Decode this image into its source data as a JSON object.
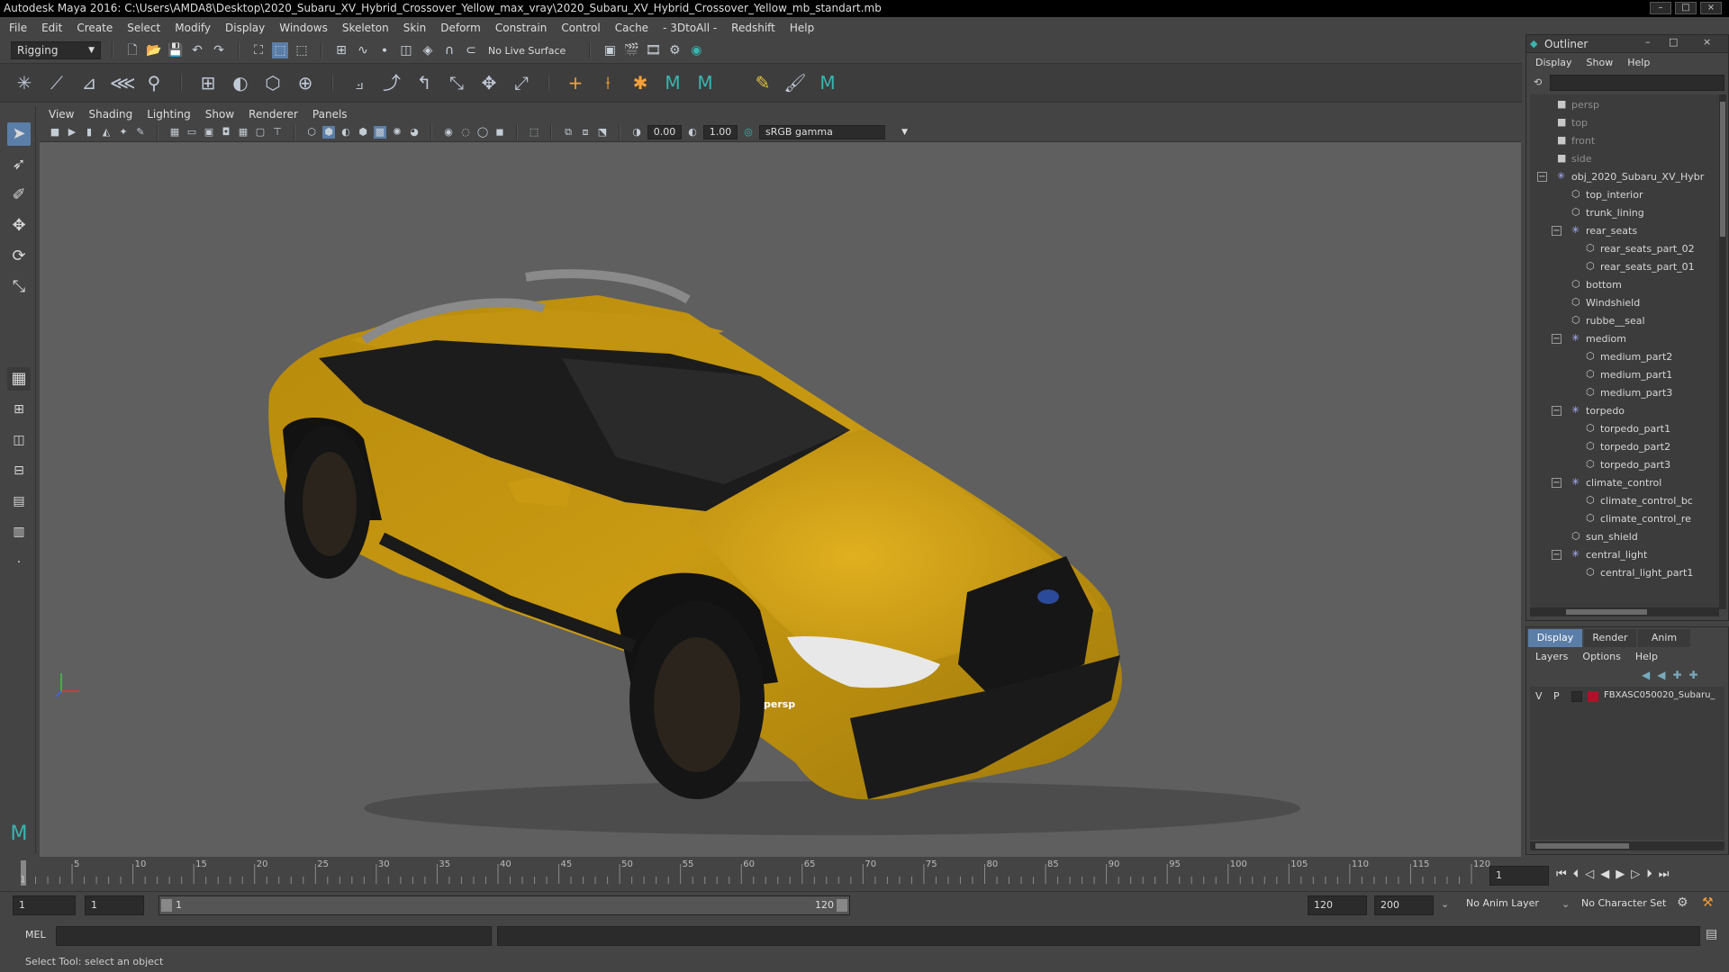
{
  "window": {
    "title": "Autodesk Maya 2016: C:\\Users\\AMDA8\\Desktop\\2020_Subaru_XV_Hybrid_Crossover_Yellow_max_vray\\2020_Subaru_XV_Hybrid_Crossover_Yellow_mb_standart.mb",
    "minimize": "–",
    "maximize": "□",
    "close": "×"
  },
  "menubar": [
    "File",
    "Edit",
    "Create",
    "Select",
    "Modify",
    "Display",
    "Windows",
    "Skeleton",
    "Skin",
    "Deform",
    "Constrain",
    "Control",
    "Cache",
    "- 3DtoAll -",
    "Redshift",
    "Help"
  ],
  "statusline": {
    "mode": "Rigging",
    "live_surface": "No Live Surface"
  },
  "viewport": {
    "menu": [
      "View",
      "Shading",
      "Lighting",
      "Show",
      "Renderer",
      "Panels"
    ],
    "exposure": "0.00",
    "gamma": "1.00",
    "colorspace": "sRGB gamma",
    "camera_label": "persp"
  },
  "timeline": {
    "ticks": [
      "1",
      "5",
      "10",
      "15",
      "20",
      "25",
      "30",
      "35",
      "40",
      "45",
      "50",
      "55",
      "60",
      "65",
      "70",
      "75",
      "80",
      "85",
      "90",
      "95",
      "100",
      "105",
      "110",
      "115",
      "120"
    ],
    "current_frame": "1"
  },
  "range": {
    "start": "1",
    "start_inner": "1",
    "slider_start": "1",
    "slider_end": "120",
    "end_inner": "120",
    "end": "200",
    "anim_layer": "No Anim Layer",
    "char_set": "No Character Set"
  },
  "mel": {
    "label": "MEL"
  },
  "help_line": "Select Tool: select an object",
  "outliner": {
    "title": "Outliner",
    "menu": [
      "Display",
      "Show",
      "Help"
    ],
    "items": [
      {
        "label": "persp",
        "indent": 0,
        "kind": "camera",
        "dim": true
      },
      {
        "label": "top",
        "indent": 0,
        "kind": "camera",
        "dim": true
      },
      {
        "label": "front",
        "indent": 0,
        "kind": "camera",
        "dim": true
      },
      {
        "label": "side",
        "indent": 0,
        "kind": "camera",
        "dim": true
      },
      {
        "label": "obj_2020_Subaru_XV_Hybr",
        "indent": 0,
        "kind": "group",
        "expanded": true
      },
      {
        "label": "top_interior",
        "indent": 1,
        "kind": "mesh"
      },
      {
        "label": "trunk_lining",
        "indent": 1,
        "kind": "mesh"
      },
      {
        "label": "rear_seats",
        "indent": 1,
        "kind": "group",
        "expanded": true
      },
      {
        "label": "rear_seats_part_02",
        "indent": 2,
        "kind": "mesh"
      },
      {
        "label": "rear_seats_part_01",
        "indent": 2,
        "kind": "mesh"
      },
      {
        "label": "bottom",
        "indent": 1,
        "kind": "mesh"
      },
      {
        "label": "Windshield",
        "indent": 1,
        "kind": "mesh"
      },
      {
        "label": "rubbe__seal",
        "indent": 1,
        "kind": "mesh"
      },
      {
        "label": "mediom",
        "indent": 1,
        "kind": "group",
        "expanded": true
      },
      {
        "label": "medium_part2",
        "indent": 2,
        "kind": "mesh"
      },
      {
        "label": "medium_part1",
        "indent": 2,
        "kind": "mesh"
      },
      {
        "label": "medium_part3",
        "indent": 2,
        "kind": "mesh"
      },
      {
        "label": "torpedo",
        "indent": 1,
        "kind": "group",
        "expanded": true
      },
      {
        "label": "torpedo_part1",
        "indent": 2,
        "kind": "mesh"
      },
      {
        "label": "torpedo_part2",
        "indent": 2,
        "kind": "mesh"
      },
      {
        "label": "torpedo_part3",
        "indent": 2,
        "kind": "mesh"
      },
      {
        "label": "climate_control",
        "indent": 1,
        "kind": "group",
        "expanded": true
      },
      {
        "label": "climate_control_bc",
        "indent": 2,
        "kind": "mesh"
      },
      {
        "label": "climate_control_re",
        "indent": 2,
        "kind": "mesh"
      },
      {
        "label": "sun_shield",
        "indent": 1,
        "kind": "mesh"
      },
      {
        "label": "central_light",
        "indent": 1,
        "kind": "group",
        "expanded": true
      },
      {
        "label": "central_light_part1",
        "indent": 2,
        "kind": "mesh"
      }
    ]
  },
  "layers": {
    "tabs": [
      "Display",
      "Render",
      "Anim"
    ],
    "menu": [
      "Layers",
      "Options",
      "Help"
    ],
    "row": {
      "v": "V",
      "p": "P",
      "color": "#b0102a",
      "name": "FBXASC050020_Subaru_"
    }
  },
  "colors": {
    "car_body": "#c99a12",
    "accent": "#5b7ea8"
  }
}
